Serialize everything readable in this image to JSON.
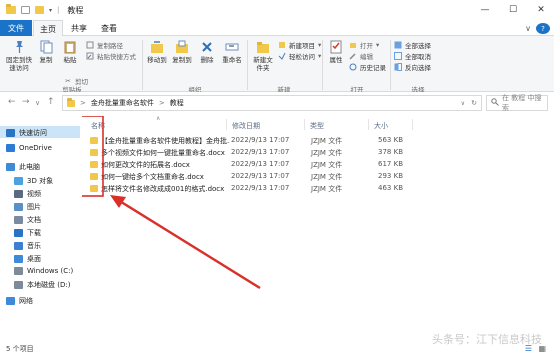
{
  "window": {
    "title": "教程",
    "minimize_symbol": "—",
    "maximize_symbol": "☐",
    "close_symbol": "✕",
    "help_symbol": "?",
    "collapse_symbol": "∨"
  },
  "tabs": [
    {
      "label": "文件"
    },
    {
      "label": "主页"
    },
    {
      "label": "共享"
    },
    {
      "label": "查看"
    }
  ],
  "ribbon": {
    "pin_label": "固定到快速访问",
    "copy_label": "复制",
    "paste_label": "粘贴",
    "cut_label": "剪切",
    "copy_path_label": "复制路径",
    "paste_shortcut_label": "粘贴快捷方式",
    "move_to_label": "移动到",
    "copy_to_label": "复制到",
    "delete_label": "删除",
    "rename_label": "重命名",
    "new_folder_label": "新建文件夹",
    "new_item_label": "新建项目",
    "easy_access_label": "轻松访问",
    "properties_label": "属性",
    "open_label": "打开",
    "edit_label": "编辑",
    "history_label": "历史记录",
    "select_all_label": "全部选择",
    "select_none_label": "全部取消",
    "invert_selection_label": "反向选择",
    "groups": {
      "clipboard": "剪贴板",
      "organize": "组织",
      "new": "新建",
      "open": "打开",
      "select": "选择"
    }
  },
  "navigation": {
    "back_symbol": "←",
    "forward_symbol": "→",
    "recent_symbol": "∨",
    "up_symbol": "↑",
    "breadcrumb": [
      "金舟批量重命名软件",
      "教程"
    ],
    "breadcrumb_separator": ">",
    "refresh_symbol": "↻",
    "search_placeholder": "在 教程 中搜索"
  },
  "sidebar": {
    "items": [
      {
        "label": "快速访问",
        "icon": "star-icon",
        "color": "#2a74c4"
      },
      {
        "label": "OneDrive",
        "icon": "cloud-icon",
        "color": "#2c7bd6"
      },
      {
        "label": "此电脑",
        "icon": "computer-icon",
        "color": "#3c8ad8"
      },
      {
        "label": "3D 对象",
        "icon": "cube-icon",
        "color": "#4aa3df"
      },
      {
        "label": "视频",
        "icon": "video-icon",
        "color": "#5a6a80"
      },
      {
        "label": "图片",
        "icon": "picture-icon",
        "color": "#5b8fc7"
      },
      {
        "label": "文档",
        "icon": "document-icon",
        "color": "#7a8aa0"
      },
      {
        "label": "下载",
        "icon": "download-icon",
        "color": "#2a74c4"
      },
      {
        "label": "音乐",
        "icon": "music-icon",
        "color": "#3d7fd0"
      },
      {
        "label": "桌面",
        "icon": "desktop-icon",
        "color": "#3c8ad8"
      },
      {
        "label": "Windows (C:)",
        "icon": "drive-icon",
        "color": "#7c8a99"
      },
      {
        "label": "本地磁盘 (D:)",
        "icon": "drive-icon",
        "color": "#7c8a99"
      },
      {
        "label": "网络",
        "icon": "network-icon",
        "color": "#3c8ad8"
      }
    ]
  },
  "file_list": {
    "columns": [
      "名称",
      "修改日期",
      "类型",
      "大小"
    ],
    "rows": [
      {
        "name": "【金舟批量重命名软件使用教程】金舟批...",
        "date": "2022/9/13 17:07",
        "type": "JZJM 文件",
        "size": "563 KB"
      },
      {
        "name": "多个视频文件如何一键批量重命名.docx",
        "date": "2022/9/13 17:07",
        "type": "JZJM 文件",
        "size": "378 KB"
      },
      {
        "name": "如何更改文件的拓展名.docx",
        "date": "2022/9/13 17:07",
        "type": "JZJM 文件",
        "size": "617 KB"
      },
      {
        "name": "如何一键给多个文档重命名.docx",
        "date": "2022/9/13 17:07",
        "type": "JZJM 文件",
        "size": "293 KB"
      },
      {
        "name": "怎样将文件名修改成成001的格式.docx",
        "date": "2022/9/13 17:07",
        "type": "JZJM 文件",
        "size": "463 KB"
      }
    ]
  },
  "status": {
    "item_count": "5 个项目"
  },
  "watermark": "头条号：江下信息科技",
  "colors": {
    "accent": "#1a73c8",
    "annotation": "#d9302a",
    "folder": "#f2c84b"
  }
}
